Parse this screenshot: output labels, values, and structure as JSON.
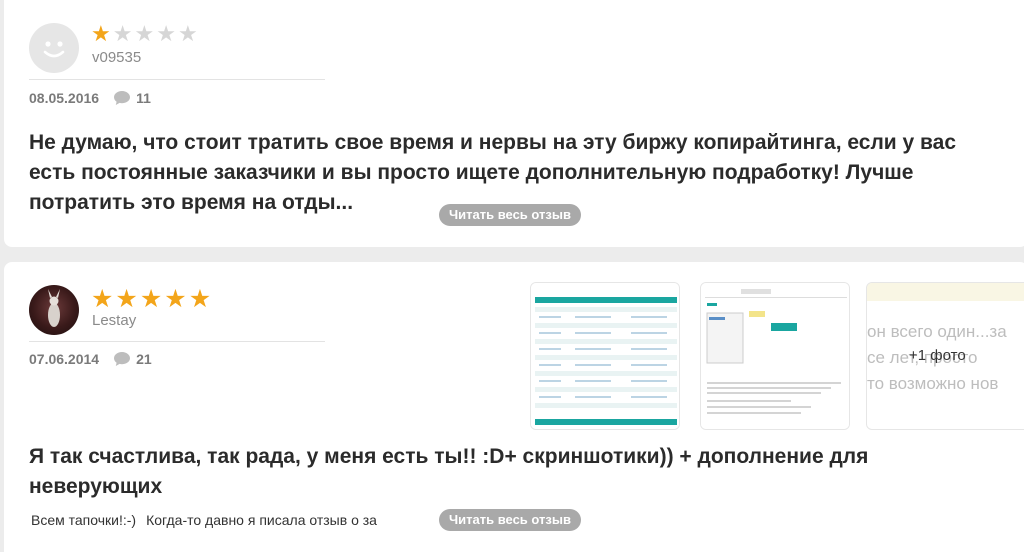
{
  "reviews": [
    {
      "rating": 1,
      "max_rating": 5,
      "username": "v09535",
      "date": "08.05.2016",
      "comments": "11",
      "text": "Не думаю, что стоит тратить свое время и нервы на эту биржу копирайтинга, если у вас есть постоянные заказчики и вы просто ищете дополнительную подработку! Лучше потратить это время на отды...",
      "read_more": "Читать весь отзыв"
    },
    {
      "rating": 5,
      "max_rating": 5,
      "username": "Lestay",
      "date": "07.06.2014",
      "comments": "21",
      "text": "Я так счастлива, так рада, у меня есть ты!! :D+ скриншотики)) + дополнение для неверующих",
      "sub_text": "Всем тапочки!:-)",
      "snippet": "Когда-то давно я писала отзыв о за",
      "read_more": "Читать весь отзыв",
      "more_photos": "+1 фото",
      "photo_text_lines": [
        "он всего один...за",
        "се лет, просто",
        "то возможно нов"
      ]
    }
  ],
  "colors": {
    "star_on": "#f3a51a",
    "star_off": "#d6d6d6",
    "read_more_bg": "#a9a9a9"
  }
}
